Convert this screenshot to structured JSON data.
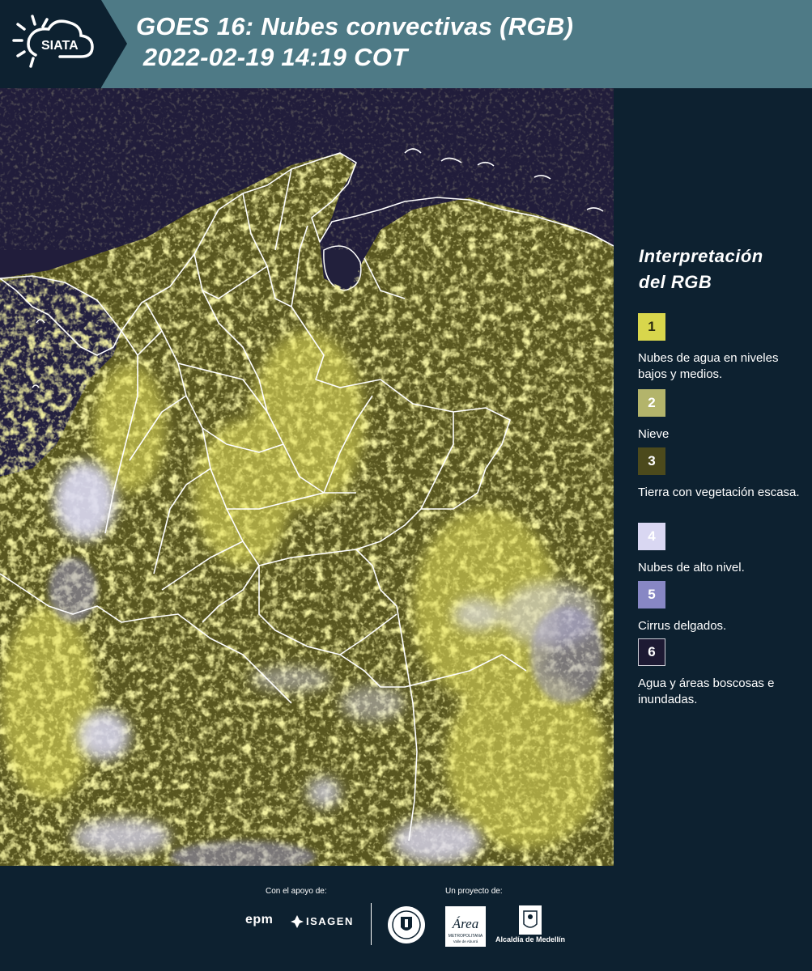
{
  "header": {
    "logo_text": "SIATA",
    "title_line1": "GOES 16: Nubes convectivas (RGB)",
    "title_line2": " 2022-02-19 14:19 COT"
  },
  "legend": {
    "title_line1": "Interpretación",
    "title_line2": "del RGB",
    "items": [
      {
        "number": "1",
        "label": "Nubes de agua en niveles bajos y medios.",
        "color": "#d8d64c",
        "text_color": "#2a2a10"
      },
      {
        "number": "2",
        "label": "Nieve",
        "color": "#b3b46b",
        "text_color": "#ffffff"
      },
      {
        "number": "3",
        "label": "Tierra con vegetación escasa.",
        "color": "#4c4a1c",
        "text_color": "#ffffff"
      },
      {
        "number": "4",
        "label": "Nubes de alto nivel.",
        "color": "#d9d7f2",
        "text_color": "#ffffff"
      },
      {
        "number": "5",
        "label": "Cirrus delgados.",
        "color": "#8787c4",
        "text_color": "#ffffff"
      },
      {
        "number": "6",
        "label": "Agua y áreas boscosas e inundadas.",
        "color": "#1d1a33",
        "text_color": "#ffffff"
      }
    ]
  },
  "footer": {
    "support_label": "Con el apoyo de:",
    "project_label": "Un proyecto de:",
    "epm": "epm",
    "isagen": "ISAGEN",
    "area_text": "Área",
    "area_sub": "METROPOLITANA",
    "area_sub2": "Valle de Aburrá",
    "alcaldia": "Alcaldía de Medellín"
  },
  "colors": {
    "navy": "#0d2130",
    "header_teal": "#4e7a86",
    "ocean": "#23203f",
    "cloud_yellow": "#e6e25a",
    "veg_olive": "#5f5d22",
    "high_cloud": "#d9d7f2"
  }
}
